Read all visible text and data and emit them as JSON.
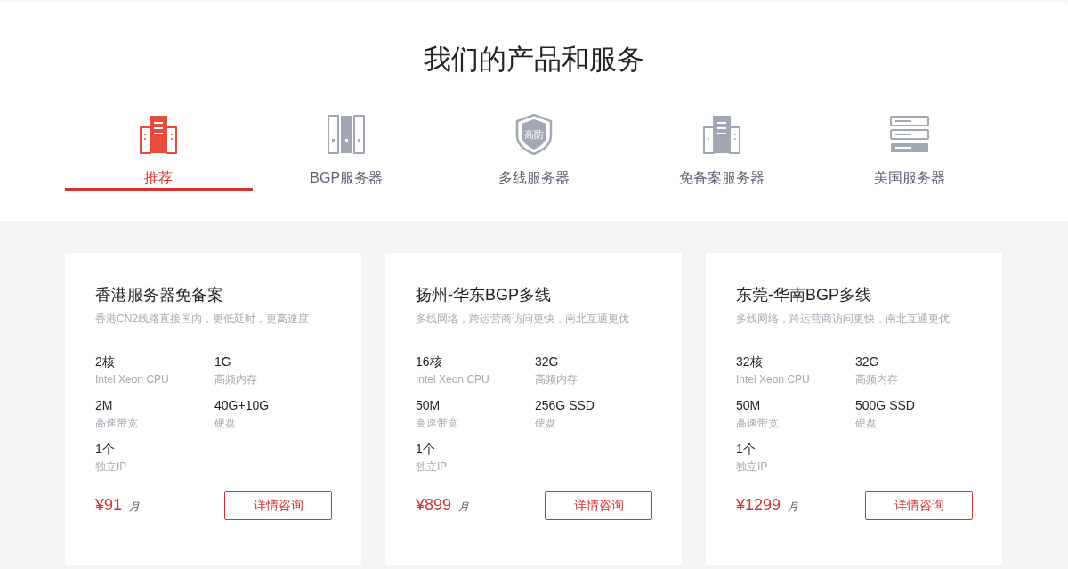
{
  "heading": "我们的产品和服务",
  "tabs": [
    {
      "kind": "recommend",
      "label": "推荐",
      "selected": true
    },
    {
      "kind": "racks",
      "label": "BGP服务器",
      "selected": false
    },
    {
      "kind": "shield",
      "label": "多线服务器",
      "selected": false,
      "icon_text": "高防"
    },
    {
      "kind": "tower",
      "label": "免备案服务器",
      "selected": false
    },
    {
      "kind": "stack",
      "label": "美国服务器",
      "selected": false
    }
  ],
  "products": [
    {
      "title": "香港服务器免备案",
      "subtitle": "香港CN2线路直接国内，更低延时，更高速度",
      "specs": [
        {
          "value": "2核",
          "label": "Intel Xeon CPU"
        },
        {
          "value": "1G",
          "label": "高频内存"
        },
        {
          "value": "2M",
          "label": "高速带宽"
        },
        {
          "value": "40G+10G",
          "label": "硬盘"
        },
        {
          "value": "1个",
          "label": "独立IP"
        }
      ],
      "price": "¥91",
      "unit": "月",
      "button": "详情咨询"
    },
    {
      "title": "扬州-华东BGP多线",
      "subtitle": "多线网络，跨运营商访问更快，南北互通更优",
      "specs": [
        {
          "value": "16核",
          "label": "Intel Xeon CPU"
        },
        {
          "value": "32G",
          "label": "高频内存"
        },
        {
          "value": "50M",
          "label": "高速带宽"
        },
        {
          "value": "256G SSD",
          "label": "硬盘"
        },
        {
          "value": "1个",
          "label": "独立IP"
        }
      ],
      "price": "¥899",
      "unit": "月",
      "button": "详情咨询"
    },
    {
      "title": "东莞-华南BGP多线",
      "subtitle": "多线网络，跨运营商访问更快，南北互通更优",
      "specs": [
        {
          "value": "32核",
          "label": "Intel Xeon CPU"
        },
        {
          "value": "32G",
          "label": "高频内存"
        },
        {
          "value": "50M",
          "label": "高速带宽"
        },
        {
          "value": "500G SSD",
          "label": "硬盘"
        },
        {
          "value": "1个",
          "label": "独立IP"
        }
      ],
      "price": "¥1299",
      "unit": "月",
      "button": "详情咨询"
    }
  ]
}
